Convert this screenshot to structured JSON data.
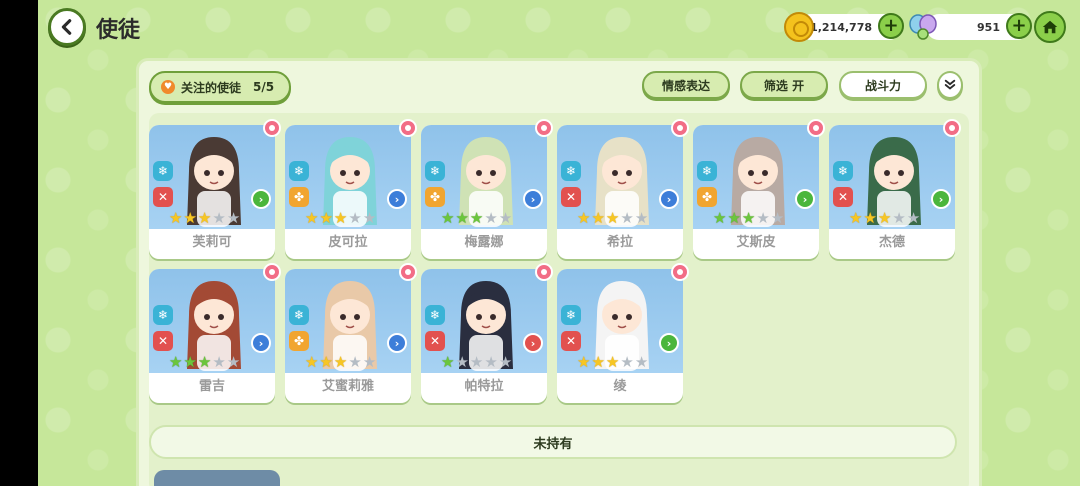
{
  "header": {
    "title": "使徒",
    "gold": "1,214,778",
    "gems": "951"
  },
  "panel": {
    "follow_label": "关注的使徒",
    "follow_count": "5/5",
    "buttons": {
      "emotion": "情感表达",
      "filter": "筛选 开",
      "power": "战斗力"
    },
    "not_owned_label": "未持有"
  },
  "cards": [
    {
      "name": "芙莉可",
      "stars": 3,
      "star_color": "gold",
      "role": "red",
      "arrow": "green",
      "hair": "#4a3a34"
    },
    {
      "name": "皮可拉",
      "stars": 3,
      "star_color": "gold",
      "role": "orange",
      "arrow": "blue",
      "hair": "#7fd3d9"
    },
    {
      "name": "梅露娜",
      "stars": 3,
      "star_color": "green",
      "role": "orange",
      "arrow": "blue",
      "hair": "#cfe2b5"
    },
    {
      "name": "希拉",
      "stars": 3,
      "star_color": "gold",
      "role": "red",
      "arrow": "blue",
      "hair": "#e7e1c7"
    },
    {
      "name": "艾斯皮",
      "stars": 3,
      "star_color": "green",
      "role": "orange",
      "arrow": "green",
      "hair": "#b8aaa3"
    },
    {
      "name": "杰德",
      "stars": 3,
      "star_color": "gold",
      "role": "red",
      "arrow": "green",
      "hair": "#3a6b4a"
    },
    {
      "name": "雷吉",
      "stars": 3,
      "star_color": "green",
      "role": "red",
      "arrow": "blue",
      "hair": "#a34a35"
    },
    {
      "name": "艾蜜莉雅",
      "stars": 3,
      "star_color": "gold",
      "role": "orange",
      "arrow": "blue",
      "hair": "#e9c9a8"
    },
    {
      "name": "帕特拉",
      "stars": 1,
      "star_color": "green",
      "role": "red",
      "arrow": "red",
      "hair": "#2a2e3f"
    },
    {
      "name": "绫",
      "stars": 3,
      "star_color": "gold",
      "role": "red",
      "arrow": "green",
      "hair": "#f4f4f4"
    }
  ]
}
